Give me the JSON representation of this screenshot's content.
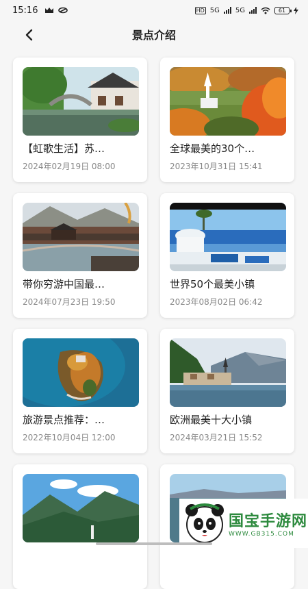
{
  "status_bar": {
    "time": "15:16",
    "network_hd": "HD",
    "network_5g_1": "5G",
    "network_5g_2": "5G",
    "battery": "61"
  },
  "header": {
    "back_icon": "back-arrow-icon",
    "title": "景点介绍"
  },
  "cards": [
    {
      "title": "【虹歌生活】苏…",
      "date": "2024年02月19日  08:00"
    },
    {
      "title": "全球最美的30个…",
      "date": "2023年10月31日  15:41"
    },
    {
      "title": "带你穷游中国最…",
      "date": "2024年07月23日  19:50"
    },
    {
      "title": "世界50个最美小镇",
      "date": "2023年08月02日  06:42"
    },
    {
      "title": "旅游景点推荐：…",
      "date": "2022年10月04日  12:00"
    },
    {
      "title": "欧洲最美十大小镇",
      "date": "2024年03月21日  15:52"
    },
    {
      "title": "",
      "date": ""
    },
    {
      "title": "",
      "date": ""
    }
  ],
  "watermark": {
    "name": "国宝手游网",
    "url": "WWW.GB315.COM"
  }
}
